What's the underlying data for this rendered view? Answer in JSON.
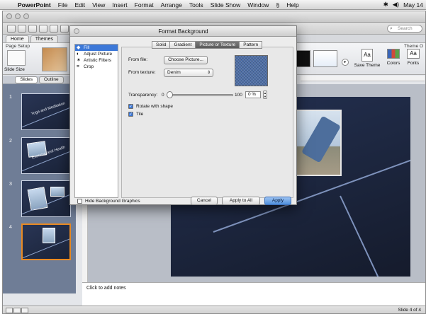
{
  "menubar": {
    "app_name": "PowerPoint",
    "items": [
      "File",
      "Edit",
      "View",
      "Insert",
      "Format",
      "Arrange",
      "Tools",
      "Slide Show",
      "Window",
      "Help"
    ],
    "date": "May 14"
  },
  "toolbar": {
    "search_placeholder": "Search"
  },
  "ribbon": {
    "tabs": [
      "Home",
      "Themes"
    ],
    "page_setup_label": "Page Setup",
    "slide_size_label": "Slide Size",
    "save_theme_label": "Save Theme",
    "theme_options_label": "Theme O",
    "colors_label": "Colors",
    "fonts_label": "Fonts"
  },
  "sidebar": {
    "tabs": [
      "Slides",
      "Outline"
    ],
    "thumbs": [
      {
        "num": "1",
        "title": "Yoga and Meditation"
      },
      {
        "num": "2",
        "title": "Exercise and Health"
      },
      {
        "num": "3",
        "title": ""
      },
      {
        "num": "4",
        "title": ""
      }
    ]
  },
  "dialog": {
    "title": "Format Background",
    "categories": [
      "Fill",
      "Adjust Picture",
      "Artistic Filters",
      "Crop"
    ],
    "tabs": [
      "Solid",
      "Gradient",
      "Picture or Texture",
      "Pattern"
    ],
    "from_file_label": "From file:",
    "choose_picture": "Choose Picture...",
    "from_texture_label": "From texture:",
    "texture_value": "Denim",
    "transparency_label": "Transparency:",
    "slider_min": "0",
    "slider_max": "100",
    "transparency_value": "0 %",
    "rotate_label": "Rotate with shape",
    "tile_label": "Tile",
    "hide_bg_label": "Hide Background Graphics",
    "cancel": "Cancel",
    "apply_all": "Apply to All",
    "apply": "Apply"
  },
  "notes": {
    "placeholder": "Click to add notes"
  },
  "status": {
    "slide_count": "Slide 4 of 4"
  },
  "colors": {
    "selection": "#3c78d8",
    "thumb_selected": "#e98a22"
  }
}
